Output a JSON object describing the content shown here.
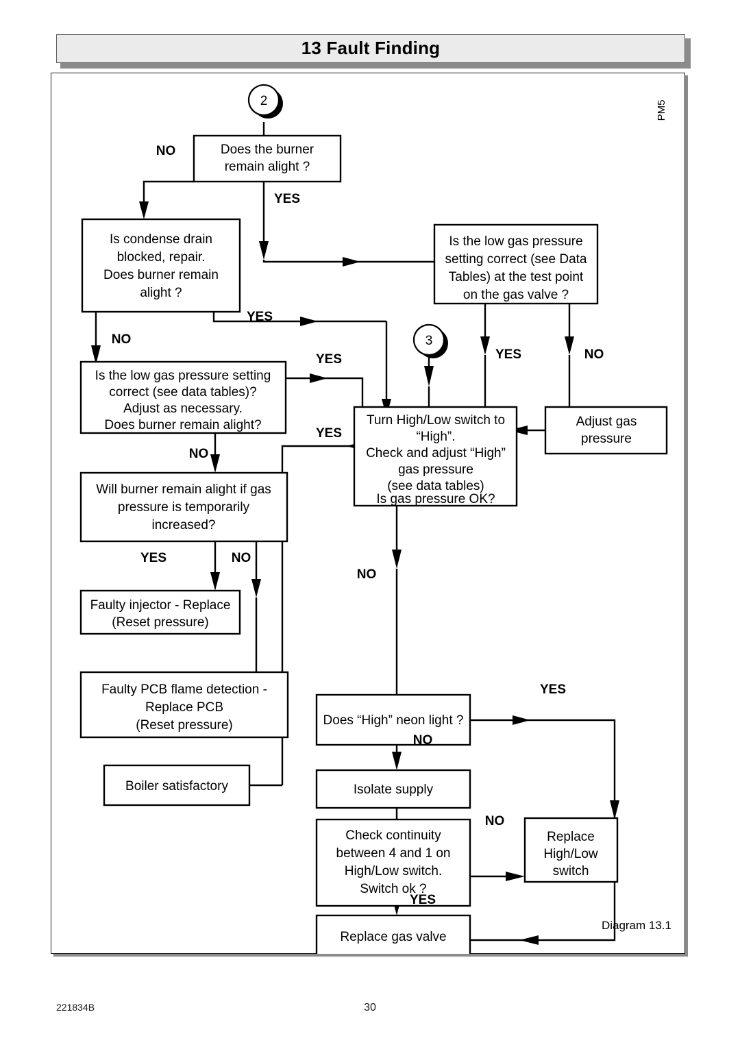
{
  "header": {
    "title": "13  Fault Finding"
  },
  "sidetag": "PM5",
  "diagram": {
    "caption": "Diagram 13.1",
    "connectors": [
      {
        "id": "conn-2",
        "label": "2"
      },
      {
        "id": "conn-3",
        "label": "3"
      }
    ],
    "nodes": [
      {
        "id": "burner-alight",
        "lines": [
          "Does the burner",
          "remain alight ?"
        ]
      },
      {
        "id": "condense-drain",
        "lines": [
          "Is condense drain",
          "blocked, repair.",
          "Does burner remain",
          "alight ?"
        ]
      },
      {
        "id": "low-gas-testpoint",
        "lines": [
          "Is the low gas pressure",
          "setting correct (see Data",
          "Tables) at the test point",
          "on the gas valve ?"
        ]
      },
      {
        "id": "low-gas-setting",
        "lines": [
          "Is the low gas pressure setting",
          "correct (see data tables)?",
          "Adjust as necessary.",
          "Does burner remain alight?"
        ]
      },
      {
        "id": "adjust-gas-pressure",
        "lines": [
          "Adjust gas",
          "pressure"
        ]
      },
      {
        "id": "turn-high-low",
        "lines": [
          "Turn High/Low switch to",
          "“High”.",
          "Check and adjust “High”",
          "gas pressure",
          "(see data tables)",
          "Is gas pressure OK?"
        ]
      },
      {
        "id": "temp-increase",
        "lines": [
          "Will burner remain alight if gas",
          "pressure is temporarily",
          "increased?"
        ]
      },
      {
        "id": "faulty-injector",
        "lines": [
          "Faulty injector - Replace",
          "(Reset pressure)"
        ]
      },
      {
        "id": "faulty-pcb",
        "lines": [
          "Faulty PCB flame detection -",
          "Replace PCB",
          "(Reset pressure)"
        ]
      },
      {
        "id": "boiler-satisfactory",
        "lines": [
          "Boiler satisfactory"
        ]
      },
      {
        "id": "high-neon",
        "lines": [
          "Does “High” neon light ?"
        ]
      },
      {
        "id": "isolate-supply",
        "lines": [
          "Isolate supply"
        ]
      },
      {
        "id": "check-continuity",
        "lines": [
          "Check continuity",
          "between 4 and 1 on",
          "High/Low switch.",
          "Switch ok ?"
        ]
      },
      {
        "id": "replace-switch",
        "lines": [
          "Replace",
          "High/Low",
          "switch"
        ]
      },
      {
        "id": "replace-gas-valve",
        "lines": [
          "Replace gas valve"
        ]
      }
    ],
    "edge_labels": [
      {
        "id": "no-burner-alight",
        "text": "NO"
      },
      {
        "id": "yes-burner-alight",
        "text": "YES"
      },
      {
        "id": "yes-condense-drain",
        "text": "YES"
      },
      {
        "id": "no-condense-drain",
        "text": "NO"
      },
      {
        "id": "yes-testpoint",
        "text": "YES"
      },
      {
        "id": "no-testpoint",
        "text": "NO"
      },
      {
        "id": "yes-low-gas-setting",
        "text": "YES"
      },
      {
        "id": "no-low-gas-setting",
        "text": "NO"
      },
      {
        "id": "yes-turn-high-low",
        "text": "YES"
      },
      {
        "id": "no-turn-high-low",
        "text": "NO"
      },
      {
        "id": "yes-temp-increase",
        "text": "YES"
      },
      {
        "id": "no-temp-increase",
        "text": "NO"
      },
      {
        "id": "yes-high-neon",
        "text": "YES"
      },
      {
        "id": "no-high-neon",
        "text": "NO"
      },
      {
        "id": "no-check-continuity",
        "text": "NO"
      },
      {
        "id": "yes-check-continuity",
        "text": "YES"
      }
    ]
  },
  "footer": {
    "doc_code": "221834B",
    "page_number": "30"
  }
}
